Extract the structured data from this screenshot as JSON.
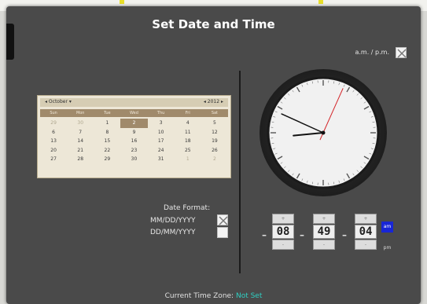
{
  "dialog": {
    "title": "Set Date and Time"
  },
  "ampm_toggle": {
    "label": "a.m. / p.m.",
    "checked": true
  },
  "calendar": {
    "month": "October",
    "year": "2012",
    "weekdays": [
      "Sun",
      "Mon",
      "Tue",
      "Wed",
      "Thu",
      "Fri",
      "Sat"
    ],
    "weeks": [
      [
        "29",
        "30",
        "1",
        "2",
        "3",
        "4",
        "5"
      ],
      [
        "6",
        "7",
        "8",
        "9",
        "10",
        "11",
        "12"
      ],
      [
        "13",
        "14",
        "15",
        "16",
        "17",
        "18",
        "19"
      ],
      [
        "20",
        "21",
        "22",
        "23",
        "24",
        "25",
        "26"
      ],
      [
        "27",
        "28",
        "29",
        "30",
        "31",
        "1",
        "2"
      ]
    ],
    "selected_day": "2"
  },
  "date_format": {
    "title": "Date Format:",
    "options": [
      {
        "label": "MM/DD/YYYY",
        "checked": true
      },
      {
        "label": "DD/MM/YYYY",
        "checked": false
      }
    ]
  },
  "time": {
    "hours": "08",
    "minutes": "49",
    "seconds": "04",
    "am_label": "am",
    "pm_label": "pm",
    "selected_period": "am"
  },
  "clock": {
    "hour": 8,
    "minute": 49,
    "second": 4
  },
  "timezone": {
    "label": "Current Time Zone:",
    "value": "Not Set"
  },
  "colors": {
    "panel": "#4a4a4a",
    "accent": "#2fd0c3",
    "period_active": "#1826d6",
    "second_hand": "#d4262a"
  }
}
